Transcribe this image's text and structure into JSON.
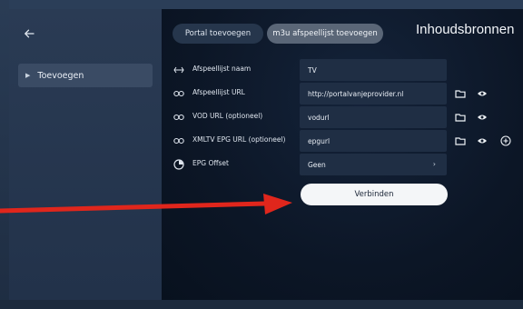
{
  "sidebar": {
    "back_icon": "arrow-left-icon",
    "items": [
      {
        "label": "Toevoegen",
        "icon": "chevron-right-icon"
      }
    ]
  },
  "header": {
    "title": "Inhoudsbronnen",
    "tabs": [
      {
        "label": "Portal toevoegen",
        "active": false
      },
      {
        "label": "m3u afspeellijst toevoegen",
        "active": true
      }
    ]
  },
  "form": {
    "rows": [
      {
        "label": "Afspeellijst naam",
        "icon": "back-arrows-icon",
        "value": "TV",
        "actions": []
      },
      {
        "label": "Afspeellijst URL",
        "icon": "link-icon",
        "value": "http://portalvanjeprovider.nl",
        "actions": [
          "folder-icon",
          "eye-icon"
        ]
      },
      {
        "label": "VOD URL (optioneel)",
        "icon": "link-icon",
        "value": "vodurl",
        "actions": [
          "folder-icon",
          "eye-icon"
        ]
      },
      {
        "label": "XMLTV EPG URL (optioneel)",
        "icon": "link-icon",
        "value": "epgurl",
        "actions": [
          "folder-icon",
          "eye-icon",
          "plus-circle-icon"
        ]
      },
      {
        "label": "EPG Offset",
        "icon": "timer-icon",
        "value": "Geen",
        "dropdown": true,
        "actions": []
      }
    ],
    "connect_label": "Verbinden"
  },
  "colors": {
    "annotation_arrow": "#e0261c",
    "accent_active_tab": "#5a6677",
    "button_bg": "#f4f6f8"
  }
}
